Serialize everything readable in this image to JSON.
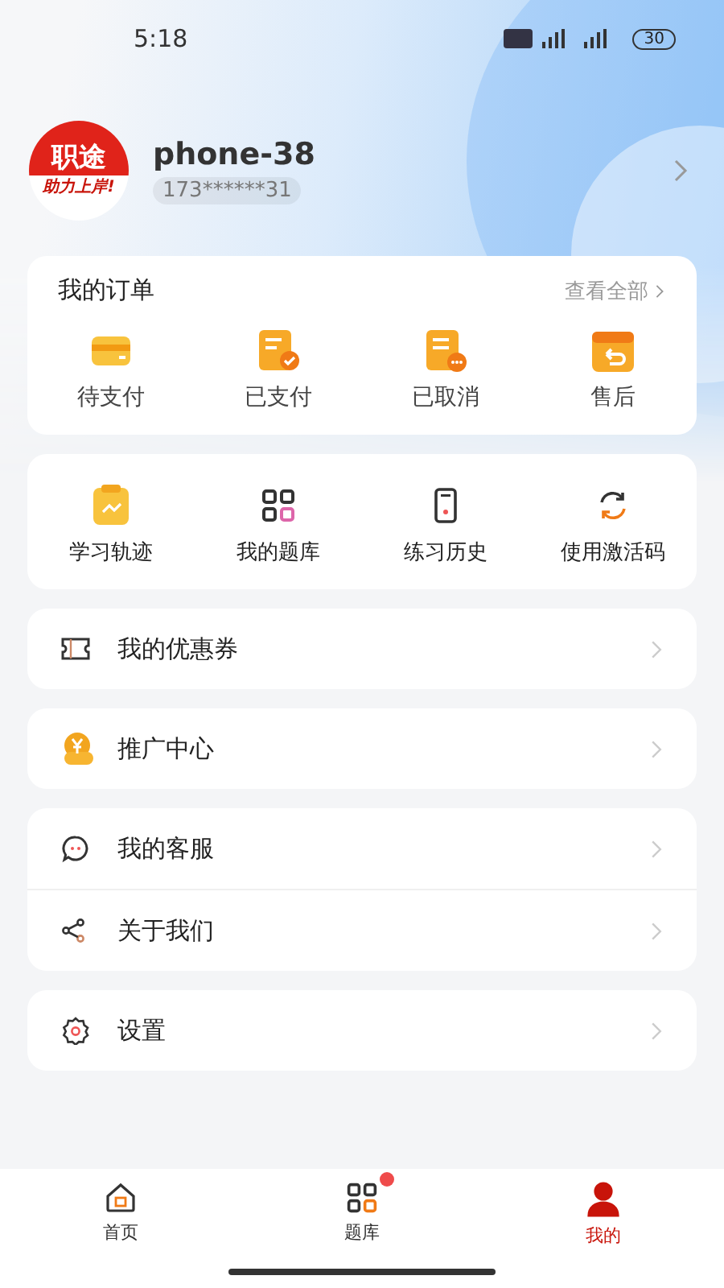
{
  "status_bar": {
    "time": "5:18",
    "battery": "30"
  },
  "profile": {
    "logo_title": "职途",
    "logo_slogan": "助力上岸!",
    "name": "phone-38",
    "phone": "173******31"
  },
  "orders": {
    "title": "我的订单",
    "view_all": "查看全部",
    "items": [
      {
        "label": "待支付",
        "kind": "wallet"
      },
      {
        "label": "已支付",
        "kind": "paid"
      },
      {
        "label": "已取消",
        "kind": "cancelled"
      },
      {
        "label": "售后",
        "kind": "return"
      }
    ]
  },
  "tools": [
    {
      "label": "学习轨迹",
      "kind": "track"
    },
    {
      "label": "我的题库",
      "kind": "bank"
    },
    {
      "label": "练习历史",
      "kind": "history"
    },
    {
      "label": "使用激活码",
      "kind": "code"
    }
  ],
  "menu_groups": [
    [
      {
        "label": "我的优惠券",
        "kind": "coupon"
      }
    ],
    [
      {
        "label": "推广中心",
        "kind": "promo"
      }
    ],
    [
      {
        "label": "我的客服",
        "kind": "service"
      },
      {
        "label": "关于我们",
        "kind": "about"
      }
    ],
    [
      {
        "label": "设置",
        "kind": "settings"
      }
    ]
  ],
  "tab_bar": [
    {
      "label": "首页",
      "kind": "home",
      "selected": false,
      "badge": false
    },
    {
      "label": "题库",
      "kind": "bank",
      "selected": false,
      "badge": true
    },
    {
      "label": "我的",
      "kind": "me",
      "selected": true,
      "badge": false
    }
  ]
}
